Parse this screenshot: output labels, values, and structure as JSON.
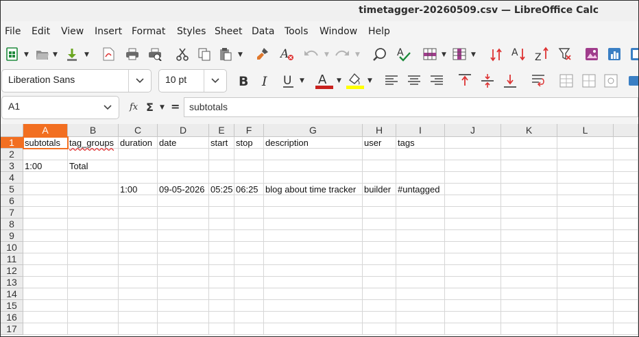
{
  "window": {
    "title": "timetagger-20260509.csv — LibreOffice Calc"
  },
  "menu": [
    "File",
    "Edit",
    "View",
    "Insert",
    "Format",
    "Styles",
    "Sheet",
    "Data",
    "Tools",
    "Window",
    "Help"
  ],
  "toolbar": {
    "font_name": "Liberation Sans",
    "font_size": "10 pt",
    "colors": {
      "font_color": "#c9211e",
      "highlight": "#ffff00"
    }
  },
  "formula_bar": {
    "name_box": "A1",
    "content": "subtotals",
    "function_wizard_label": "fx",
    "sum_label": "Σ",
    "equals_label": "="
  },
  "sheet": {
    "columns": [
      "A",
      "B",
      "C",
      "D",
      "E",
      "F",
      "G",
      "H",
      "I",
      "J",
      "K",
      "L"
    ],
    "rows": [
      "1",
      "2",
      "3",
      "4",
      "5",
      "6",
      "7",
      "8",
      "9",
      "10",
      "11",
      "12",
      "13",
      "14",
      "15",
      "16",
      "17"
    ],
    "selected_cell": "A1",
    "data": [
      [
        "subtotals",
        "tag_groups",
        "duration",
        "date",
        "start",
        "stop",
        "description",
        "user",
        "tags",
        "",
        "",
        ""
      ],
      [
        "",
        "",
        "",
        "",
        "",
        "",
        "",
        "",
        "",
        "",
        "",
        ""
      ],
      [
        "1:00",
        "Total",
        "",
        "",
        "",
        "",
        "",
        "",
        "",
        "",
        "",
        ""
      ],
      [
        "",
        "",
        "",
        "",
        "",
        "",
        "",
        "",
        "",
        "",
        "",
        ""
      ],
      [
        "",
        "",
        "1:00",
        "09-05-2026",
        "05:25",
        "06:25",
        "blog about time tracker",
        "builder",
        "#untagged",
        "",
        "",
        ""
      ]
    ]
  },
  "accent_color": "#f26f21"
}
